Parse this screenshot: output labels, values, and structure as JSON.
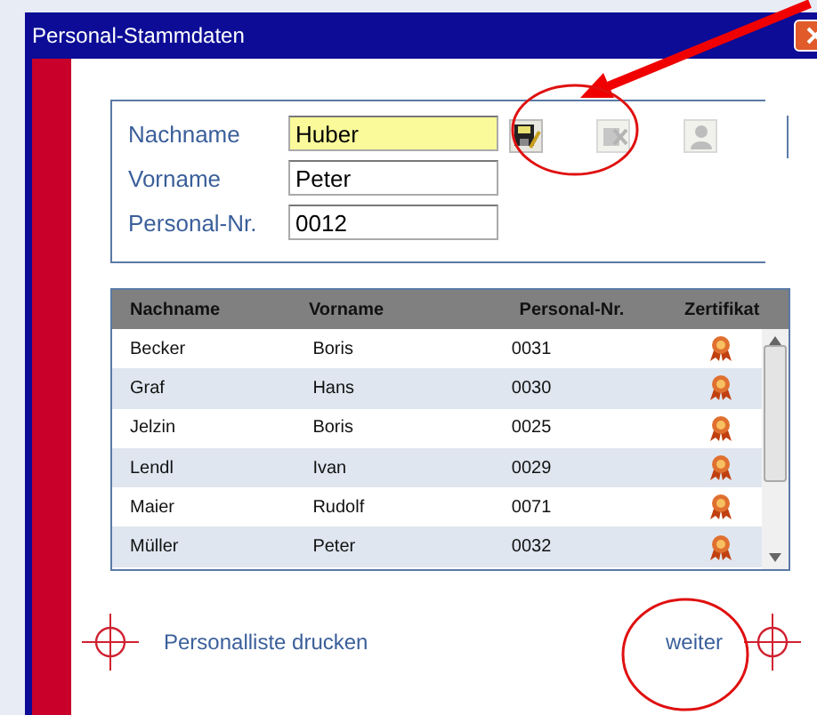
{
  "window": {
    "title": "Personal-Stammdaten"
  },
  "form": {
    "fields": [
      {
        "label": "Nachname",
        "value": "Huber",
        "highlighted": true
      },
      {
        "label": "Vorname",
        "value": "Peter",
        "highlighted": false
      },
      {
        "label": "Personal-Nr.",
        "value": "0012",
        "highlighted": false
      }
    ],
    "tools": [
      {
        "kind": "save",
        "disabled": false
      },
      {
        "kind": "delete",
        "disabled": true
      },
      {
        "kind": "person",
        "disabled": true
      }
    ]
  },
  "table": {
    "columns": [
      "Nachname",
      "Vorname",
      "Personal-Nr.",
      "Zertifikat"
    ],
    "rows": [
      [
        "Becker",
        "Boris",
        "0031"
      ],
      [
        "Graf",
        "Hans",
        "0030"
      ],
      [
        "Jelzin",
        "Boris",
        "0025"
      ],
      [
        "Lendl",
        "Ivan",
        "0029"
      ],
      [
        "Maier",
        "Rudolf",
        "0071"
      ],
      [
        "Müller",
        "Peter",
        "0032"
      ]
    ]
  },
  "footer": {
    "print_link": "Personalliste drucken",
    "next_link": "weiter"
  }
}
